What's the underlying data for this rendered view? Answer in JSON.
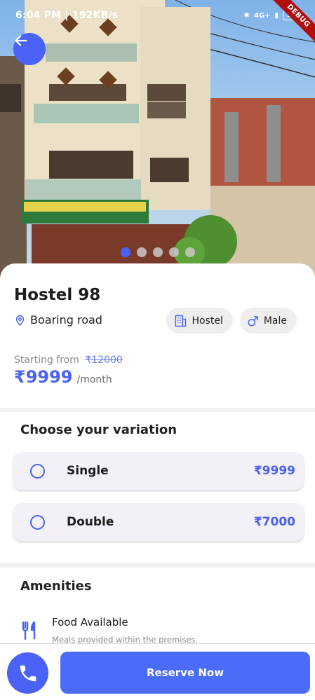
{
  "status_bar": {
    "time": "6:04 PM | 192KB/s",
    "network": "4G+",
    "battery": "13",
    "debug_banner": "DEBUG"
  },
  "header": {
    "back_icon": "arrow-left-icon",
    "carousel_total": 5,
    "carousel_active": 0
  },
  "listing": {
    "title": "Hostel 98",
    "location": "Boaring road",
    "chips": [
      {
        "icon": "building-icon",
        "label": "Hostel"
      },
      {
        "icon": "male-icon",
        "label": "Male"
      }
    ],
    "starting_label": "Starting from",
    "old_price": "₹12000",
    "price": "₹9999",
    "price_unit": "/month"
  },
  "variation": {
    "title": "Choose your variation",
    "options": [
      {
        "label": "Single",
        "price": "₹9999",
        "selected": false
      },
      {
        "label": "Double",
        "price": "₹7000",
        "selected": false
      }
    ]
  },
  "amenities": {
    "title": "Amenities",
    "items": [
      {
        "icon": "food-icon",
        "title": "Food Available",
        "description": "Meals provided within the premises."
      }
    ]
  },
  "bottom": {
    "call_icon": "phone-icon",
    "reserve_label": "Reserve Now"
  },
  "colors": {
    "accent": "#4a62f5",
    "chip_bg": "#eeeeee",
    "card_bg": "#f3f1f7"
  }
}
